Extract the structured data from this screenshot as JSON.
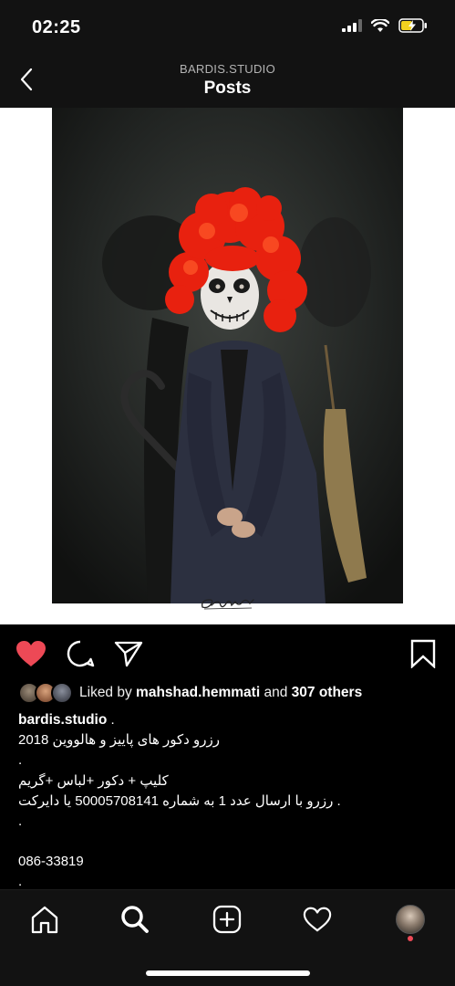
{
  "status": {
    "time": "02:25",
    "icons": [
      "signal-icon",
      "wifi-icon",
      "battery-charging-icon"
    ]
  },
  "header": {
    "account": "BARDIS.STUDIO",
    "title": "Posts",
    "back_icon": "chevron-left-icon"
  },
  "post": {
    "image_signature": "Bardis",
    "actions": {
      "like_icon": "heart-filled-icon",
      "comment_icon": "comment-icon",
      "share_icon": "paper-plane-icon",
      "save_icon": "bookmark-icon"
    },
    "likes": {
      "prefix": "Liked by",
      "liker": "mahshad.hemmati",
      "conj": "and",
      "others": "307 others"
    },
    "caption": {
      "username": "bardis.studio",
      "username_suffix": " .",
      "lines": [
        "رزرو دکور های پاییز و هالووین 2018",
        ".",
        "کلیپ + دکور +لباس +گریم",
        ".  رزرو با ارسال عدد 1 به شماره 50005708141 یا دایرکت",
        ".",
        "",
        "086-33819",
        "."
      ]
    }
  },
  "tabbar": {
    "items": [
      "home-icon",
      "search-icon",
      "new-post-icon",
      "activity-heart-icon",
      "profile-avatar"
    ]
  },
  "colors": {
    "like_red": "#ed4956",
    "bar_bg": "#121212",
    "background": "#000000"
  }
}
